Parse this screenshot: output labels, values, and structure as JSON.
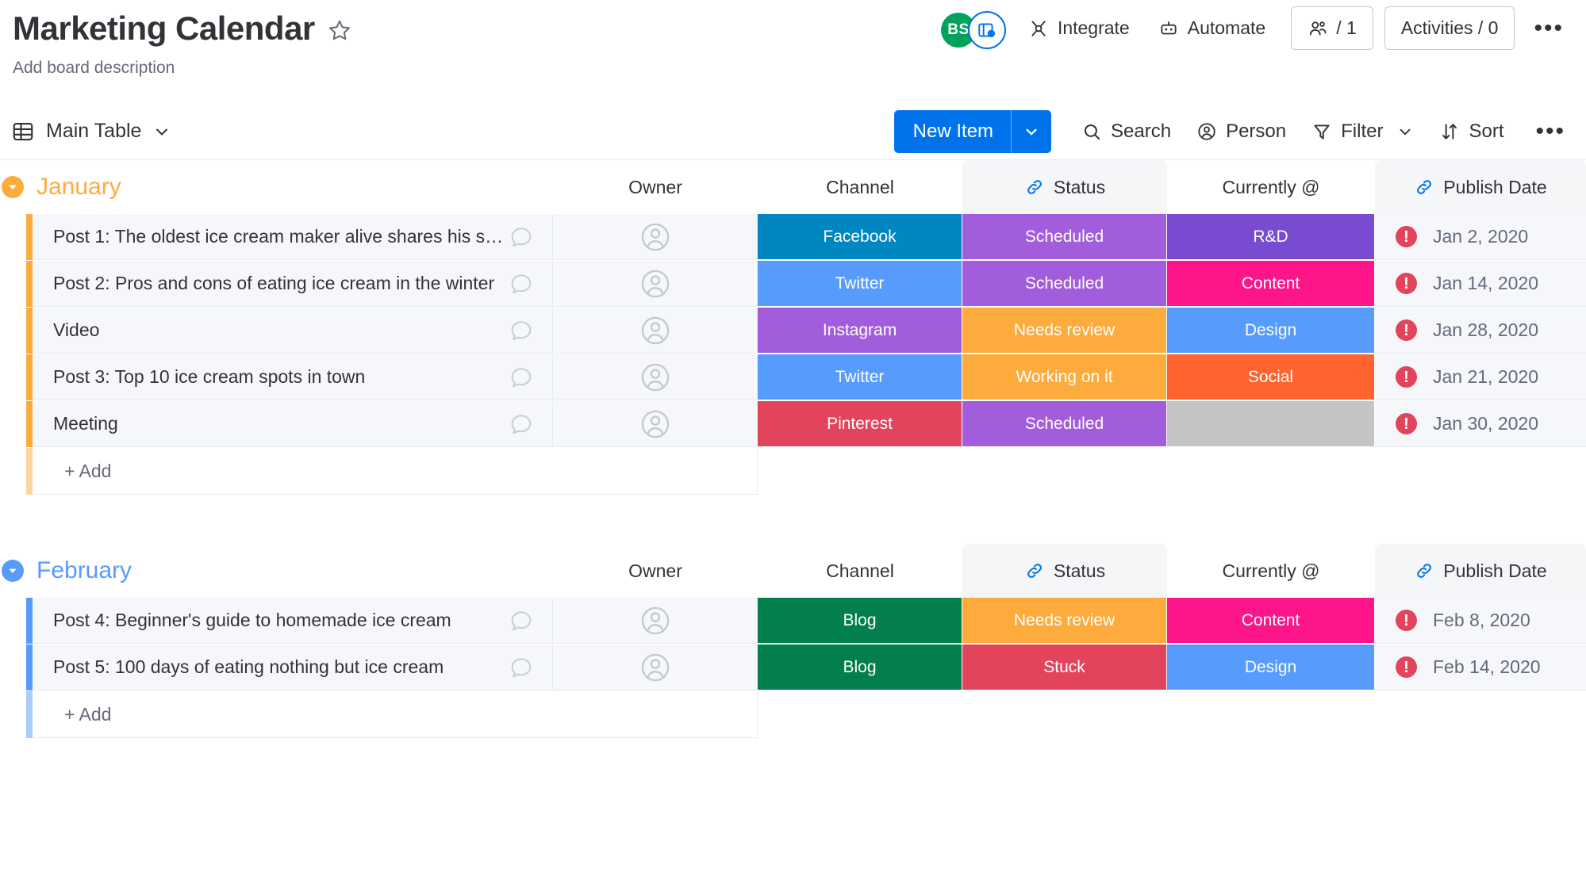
{
  "header": {
    "title": "Marketing Calendar",
    "description": "Add board description",
    "star_icon": "star-icon",
    "avatar_initials": "BS",
    "board_kind_icon": "board-visibility-icon",
    "integrate_label": "Integrate",
    "integrate_icon": "integrate-icon",
    "automate_label": "Automate",
    "automate_icon": "robot-icon",
    "members_label": "/ 1",
    "members_icon": "people-icon",
    "activities_label": "Activities / 0",
    "more_label": "•••"
  },
  "toolbar": {
    "view_label": "Main Table",
    "view_icon": "table-icon",
    "view_caret_icon": "chevron-down-icon",
    "new_item_label": "New Item",
    "new_item_caret_icon": "chevron-down-icon",
    "search_label": "Search",
    "search_icon": "search-icon",
    "person_label": "Person",
    "person_icon": "person-icon",
    "filter_label": "Filter",
    "filter_icon": "filter-icon",
    "filter_caret_icon": "chevron-down-icon",
    "sort_label": "Sort",
    "sort_icon": "sort-icon",
    "more_label": "•••"
  },
  "columns": [
    {
      "label": "Owner",
      "linked": false
    },
    {
      "label": "Channel",
      "linked": false
    },
    {
      "label": "Status",
      "linked": true,
      "link_icon": "link-icon"
    },
    {
      "label": "Currently @",
      "linked": false
    },
    {
      "label": "Publish Date",
      "linked": true,
      "link_icon": "link-icon"
    }
  ],
  "add_row_label": "+ Add",
  "colors": {
    "accent_blue": "#0073ea",
    "january": "#fdab3d",
    "february": "#579bfc",
    "facebook": "#0086c0",
    "twitter": "#579bfc",
    "instagram": "#a25ddc",
    "pinterest": "#e2445c",
    "blog": "#037f4c",
    "scheduled": "#a25ddc",
    "needs_review": "#fdab3d",
    "working_on_it": "#fdab3d",
    "stuck": "#e2445c",
    "rd": "#784bd1",
    "content": "#ff158a",
    "design": "#579bfc",
    "social": "#ff642e",
    "empty": "#c4c4c4",
    "alert": "#e2445c"
  },
  "groups": [
    {
      "name": "January",
      "color": "#fdab3d",
      "collapse_icon": "chevron-down-icon",
      "items": [
        {
          "name": "Post 1: The oldest ice cream maker alive shares his s…",
          "owner": "",
          "channel": "Facebook",
          "channel_color": "#0086c0",
          "status": "Scheduled",
          "status_color": "#a25ddc",
          "currently_at": "R&D",
          "currently_at_color": "#784bd1",
          "publish_date": "Jan 2, 2020",
          "has_alert": true
        },
        {
          "name": "Post 2: Pros and cons of eating ice cream in the winter",
          "owner": "",
          "channel": "Twitter",
          "channel_color": "#579bfc",
          "status": "Scheduled",
          "status_color": "#a25ddc",
          "currently_at": "Content",
          "currently_at_color": "#ff158a",
          "publish_date": "Jan 14, 2020",
          "has_alert": true
        },
        {
          "name": "Video",
          "owner": "",
          "channel": "Instagram",
          "channel_color": "#a25ddc",
          "status": "Needs review",
          "status_color": "#fdab3d",
          "currently_at": "Design",
          "currently_at_color": "#579bfc",
          "publish_date": "Jan 28, 2020",
          "has_alert": true
        },
        {
          "name": "Post 3: Top 10 ice cream spots in town",
          "owner": "",
          "channel": "Twitter",
          "channel_color": "#579bfc",
          "status": "Working on it",
          "status_color": "#fdab3d",
          "currently_at": "Social",
          "currently_at_color": "#ff642e",
          "publish_date": "Jan 21, 2020",
          "has_alert": true
        },
        {
          "name": "Meeting",
          "owner": "",
          "channel": "Pinterest",
          "channel_color": "#e2445c",
          "status": "Scheduled",
          "status_color": "#a25ddc",
          "currently_at": "",
          "currently_at_color": "#c4c4c4",
          "publish_date": "Jan 30, 2020",
          "has_alert": true
        }
      ]
    },
    {
      "name": "February",
      "color": "#579bfc",
      "collapse_icon": "chevron-down-icon",
      "items": [
        {
          "name": "Post 4: Beginner's guide to homemade ice cream",
          "owner": "",
          "channel": "Blog",
          "channel_color": "#037f4c",
          "status": "Needs review",
          "status_color": "#fdab3d",
          "currently_at": "Content",
          "currently_at_color": "#ff158a",
          "publish_date": "Feb 8, 2020",
          "has_alert": true
        },
        {
          "name": "Post 5: 100 days of eating nothing but ice cream",
          "owner": "",
          "channel": "Blog",
          "channel_color": "#037f4c",
          "status": "Stuck",
          "status_color": "#e2445c",
          "currently_at": "Design",
          "currently_at_color": "#579bfc",
          "publish_date": "Feb 14, 2020",
          "has_alert": true
        }
      ]
    }
  ]
}
